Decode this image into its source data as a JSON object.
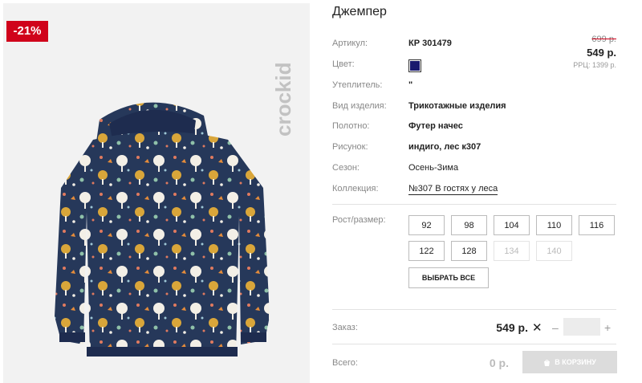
{
  "product": {
    "title": "Джемпер",
    "discount_badge": "-21%",
    "brand": "crockid"
  },
  "specs": {
    "article_label": "Артикул:",
    "article_value": "КР 301479",
    "color_label": "Цвет:",
    "color_hex": "#1a1a6e",
    "insulation_label": "Утеплитель:",
    "insulation_value": "\"",
    "type_label": "Вид изделия:",
    "type_value": "Трикотажные изделия",
    "fabric_label": "Полотно:",
    "fabric_value": "Футер начес",
    "pattern_label": "Рисунок:",
    "pattern_value": "индиго, лес к307",
    "season_label": "Сезон:",
    "season_value": "Осень-Зима",
    "collection_label": "Коллекция:",
    "collection_value": "№307 В гостях у леса"
  },
  "price": {
    "old": "699 р.",
    "current": "549 р.",
    "rrp": "РРЦ: 1399 р."
  },
  "sizes": {
    "label": "Рост/размер:",
    "options": [
      "92",
      "98",
      "104",
      "110",
      "116",
      "122",
      "128",
      "134",
      "140"
    ],
    "disabled": [
      "134",
      "140"
    ],
    "select_all_label": "ВЫБРАТЬ ВСЕ"
  },
  "order": {
    "label": "Заказ:",
    "price": "549 р.",
    "remove_glyph": "✕",
    "minus_glyph": "–",
    "plus_glyph": "+",
    "quantity": ""
  },
  "total": {
    "label": "Всего:",
    "value": "0 р.",
    "cart_button_label": "В КОРЗИНУ"
  }
}
